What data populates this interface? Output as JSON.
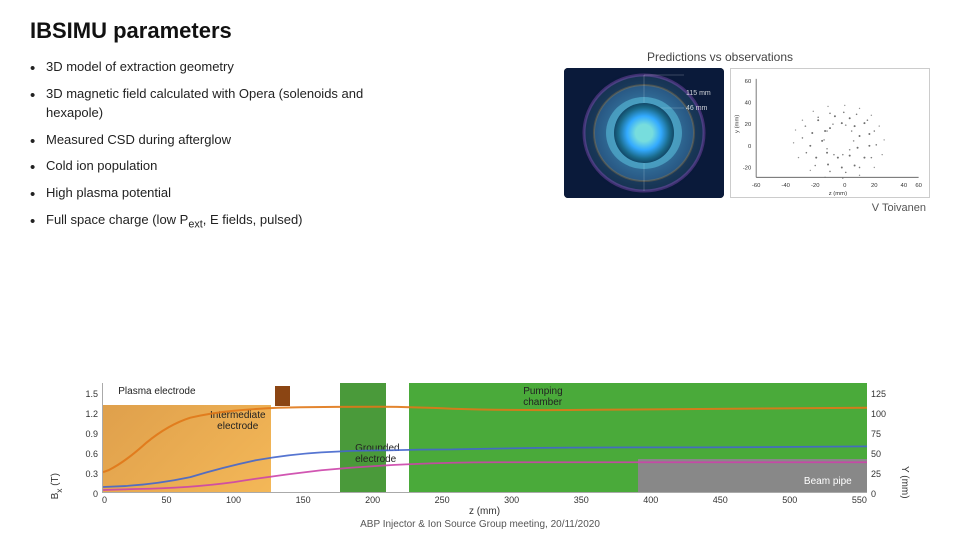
{
  "title": "IBSIMU parameters",
  "subtitle_right": "Predictions vs observations",
  "bullets": [
    "3D model of extraction geometry",
    "3D magnetic field calculated with Opera (solenoids and hexapole)",
    "Measured CSD during afterglow",
    "Cold ion population",
    "High plasma potential",
    "Full space charge (low Pₑₓₜ, E fields, pulsed)"
  ],
  "attribution": "V Toivanen",
  "chart": {
    "y_left_label": "Bₓ (T)",
    "y_right_label": "Y (mm)",
    "y_left_values": [
      "1.5",
      "1.2",
      "0.9",
      "0.6",
      "0.3",
      "0"
    ],
    "y_right_values": [
      "125",
      "100",
      "75",
      "50",
      "25",
      "0"
    ],
    "x_values": [
      "0",
      "50",
      "100",
      "150",
      "200",
      "250",
      "300",
      "350",
      "400",
      "450",
      "500",
      "550"
    ],
    "x_label": "z (mm)",
    "annotations": {
      "plasma_electrode": "Plasma electrode",
      "intermediate_electrode": "Intermediate electrode",
      "grounded_electrode": "Grounded electrode",
      "pumping_chamber": "Pumping chamber",
      "beam_pipe": "Beam pipe"
    }
  },
  "footer": "ABP Injector & Ion Source Group meeting, 20/11/2020"
}
